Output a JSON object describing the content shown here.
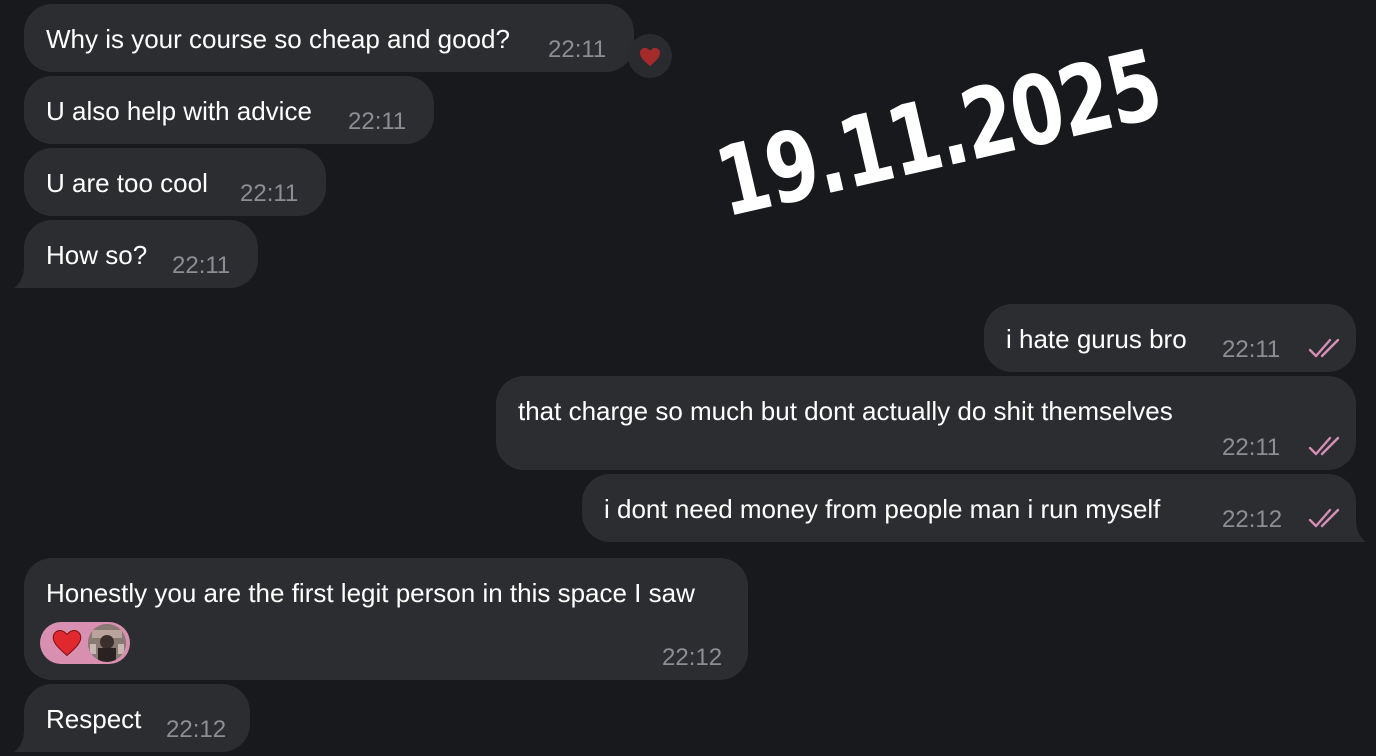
{
  "chat": {
    "messages": [
      {
        "text": "Why is your course so cheap and good?",
        "time": "22:11"
      },
      {
        "text": "U also help with advice",
        "time": "22:11"
      },
      {
        "text": "U are too cool",
        "time": "22:11"
      },
      {
        "text": "How so?",
        "time": "22:11"
      },
      {
        "text": "i hate gurus bro",
        "time": "22:11"
      },
      {
        "text": "that charge so much but dont actually do shit themselves",
        "time": "22:11"
      },
      {
        "text": "i dont need money from people man i run myself",
        "time": "22:12"
      },
      {
        "text": "Honestly you are the first legit person in this space I saw",
        "time": "22:12"
      },
      {
        "text": "Respect",
        "time": "22:12"
      }
    ]
  },
  "overlay": {
    "date_stamp": "19.11.2025"
  },
  "reactions": {
    "first_message_reaction": "heart-emoji",
    "honestly_message_reaction": "heart-emoji",
    "reactor": "avatar"
  },
  "colors": {
    "background": "#18191d",
    "bubble": "#2c2d31",
    "time_text": "#8c8e93",
    "read_checks": "#d58fb6",
    "reaction_pill": "#d98fb0",
    "heart": "#e0282e"
  }
}
